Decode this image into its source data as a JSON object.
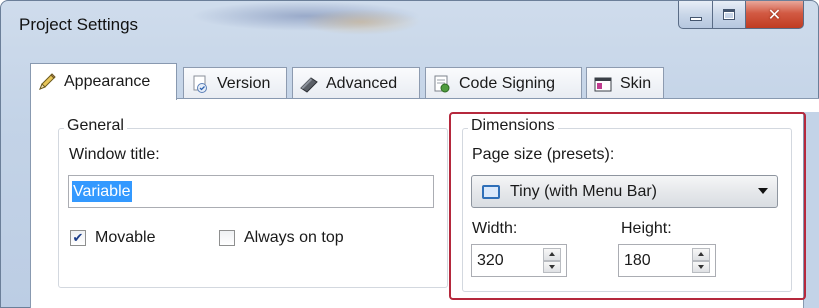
{
  "window": {
    "title": "Project Settings",
    "buttons": {
      "minimize": "minimize",
      "maximize": "maximize",
      "close": "close"
    }
  },
  "tabs": [
    {
      "label": "Appearance",
      "icon": "pencil-icon",
      "active": true
    },
    {
      "label": "Version",
      "icon": "version-icon",
      "active": false
    },
    {
      "label": "Advanced",
      "icon": "advanced-icon",
      "active": false
    },
    {
      "label": "Code Signing",
      "icon": "code-signing-icon",
      "active": false
    },
    {
      "label": "Skin",
      "icon": "skin-icon",
      "active": false
    }
  ],
  "general": {
    "legend": "General",
    "window_title_label": "Window title:",
    "window_title_value": "Variable",
    "movable_label": "Movable",
    "movable_checked": true,
    "always_on_top_label": "Always on top",
    "always_on_top_checked": false
  },
  "dimensions": {
    "legend": "Dimensions",
    "page_size_label": "Page size (presets):",
    "page_size_value": "Tiny (with Menu Bar)",
    "width_label": "Width:",
    "width_value": "320",
    "height_label": "Height:",
    "height_value": "180"
  },
  "colors": {
    "highlight_border": "#b5283c",
    "selection": "#3399ff",
    "close_button": "#c03c22"
  }
}
